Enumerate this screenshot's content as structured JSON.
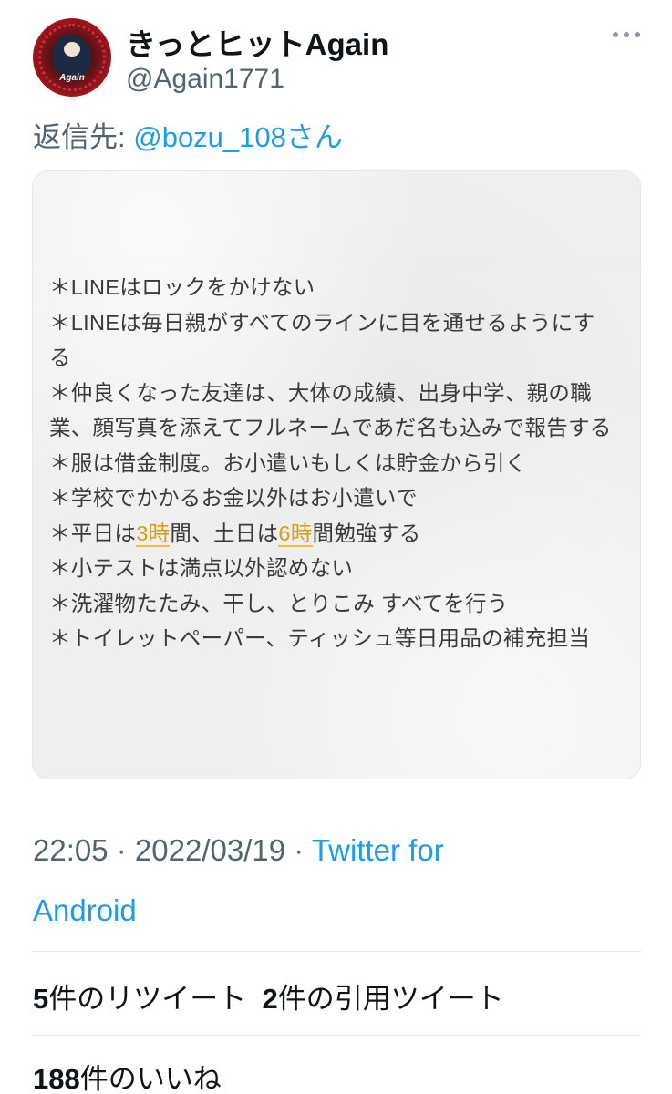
{
  "tweet": {
    "display_name": "きっとヒットAgain",
    "handle": "@Again1771",
    "avatar_label": "Again",
    "reply_prefix": "返信先: ",
    "reply_mention": "@bozu_108さん",
    "time": "22:05",
    "date": "2022/03/19",
    "source_line1": "Twitter for",
    "source_line2": "Android"
  },
  "media": {
    "lines": [
      {
        "text": "＊LINEはロックをかけない"
      },
      {
        "text": "＊LINEは毎日親がすべてのラインに目を通せるようにす"
      },
      {
        "text": "る"
      },
      {
        "text": "＊仲良くなった友達は、大体の成績、出身中学、親の職"
      },
      {
        "text": "業、顔写真を添えてフルネームであだ名も込みで報告する"
      },
      {
        "text": "＊服は借金制度。お小遣いもしくは貯金から引く"
      },
      {
        "text": "＊学校でかかるお金以外はお小遣いで"
      },
      {
        "pre": "＊平日は",
        "hl1": "3時",
        "mid": "間、土日は",
        "hl2": "6時",
        "post": "間勉強する"
      },
      {
        "text": "＊小テストは満点以外認めない"
      },
      {
        "text": "＊洗濯物たたみ、干し、とりこみ すべてを行う"
      },
      {
        "text": "＊トイレットペーパー、ティッシュ等日用品の補充担当"
      }
    ]
  },
  "stats": {
    "retweets_count": "5",
    "retweets_label": "件のリツイート",
    "quotes_count": "2",
    "quotes_label": "件の引用ツイート",
    "likes_count": "188",
    "likes_label": "件のいいね"
  },
  "colors": {
    "link": "#1d9bf0",
    "secondary_text": "#536471",
    "highlight": "#d4a017"
  }
}
